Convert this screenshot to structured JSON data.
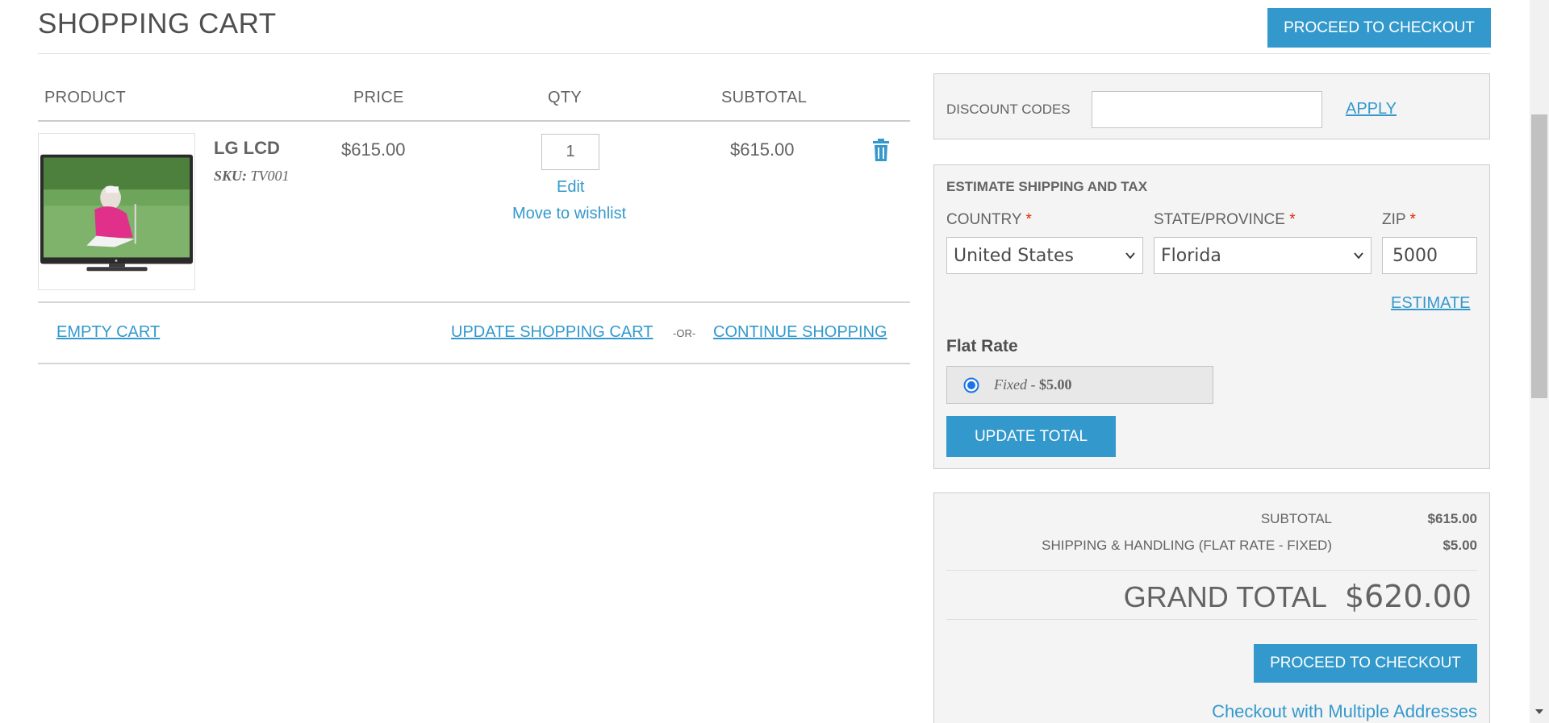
{
  "header": {
    "title": "SHOPPING CART",
    "checkout_label": "PROCEED TO CHECKOUT"
  },
  "cart": {
    "columns": {
      "product": "PRODUCT",
      "price": "PRICE",
      "qty": "QTY",
      "subtotal": "SUBTOTAL"
    },
    "items": [
      {
        "name": "LG LCD",
        "sku_label": "SKU:",
        "sku": "TV001",
        "price": "$615.00",
        "qty": "1",
        "edit_label": "Edit",
        "wishlist_label": "Move to wishlist",
        "subtotal": "$615.00"
      }
    ],
    "actions": {
      "empty": "EMPTY CART",
      "update": "UPDATE SHOPPING CART",
      "or": "-OR-",
      "continue": "CONTINUE SHOPPING"
    }
  },
  "discount": {
    "label": "DISCOUNT CODES",
    "value": "",
    "apply_label": "APPLY"
  },
  "shipping": {
    "title": "ESTIMATE SHIPPING AND TAX",
    "country_label": "COUNTRY",
    "country_value": "United States",
    "state_label": "STATE/PROVINCE",
    "state_value": "Florida",
    "zip_label": "ZIP",
    "zip_value": "5000",
    "required_mark": "*",
    "estimate_label": "ESTIMATE",
    "rate_title": "Flat Rate",
    "rate_method": "Fixed",
    "rate_separator": " - ",
    "rate_price": "$5.00",
    "update_total_label": "UPDATE TOTAL"
  },
  "totals": {
    "subtotal_label": "SUBTOTAL",
    "subtotal_value": "$615.00",
    "shipping_label": "SHIPPING & HANDLING (FLAT RATE - FIXED)",
    "shipping_value": "$5.00",
    "grand_label": "GRAND TOTAL",
    "grand_value": "$620.00",
    "checkout_label": "PROCEED TO CHECKOUT",
    "multi_address_label": "Checkout with Multiple Addresses"
  },
  "colors": {
    "accent": "#3399cc",
    "required": "#df280a",
    "text": "#636363"
  }
}
